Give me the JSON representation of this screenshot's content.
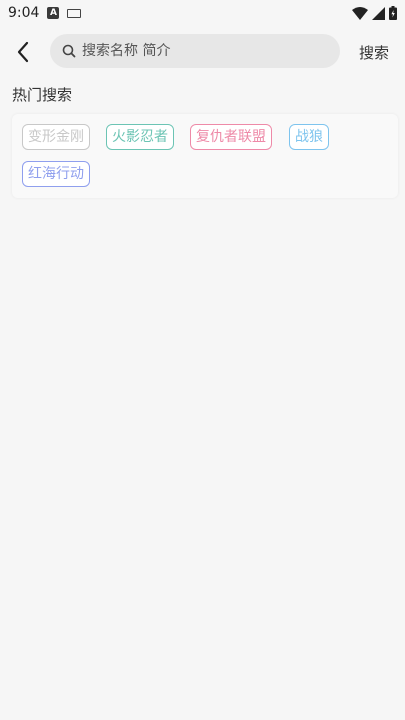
{
  "status_bar": {
    "time": "9:04",
    "notif_a": "A"
  },
  "header": {
    "search_placeholder": "搜索名称 简介",
    "search_label": "搜索"
  },
  "hot_search": {
    "title": "热门搜索",
    "tags": [
      {
        "label": "变形金刚",
        "color": "#c8c8c8"
      },
      {
        "label": "火影忍者",
        "color": "#6cc4b4"
      },
      {
        "label": "复仇者联盟",
        "color": "#ee8aa8"
      },
      {
        "label": "战狼",
        "color": "#7ec4ee"
      },
      {
        "label": "红海行动",
        "color": "#8f9fee"
      }
    ]
  }
}
